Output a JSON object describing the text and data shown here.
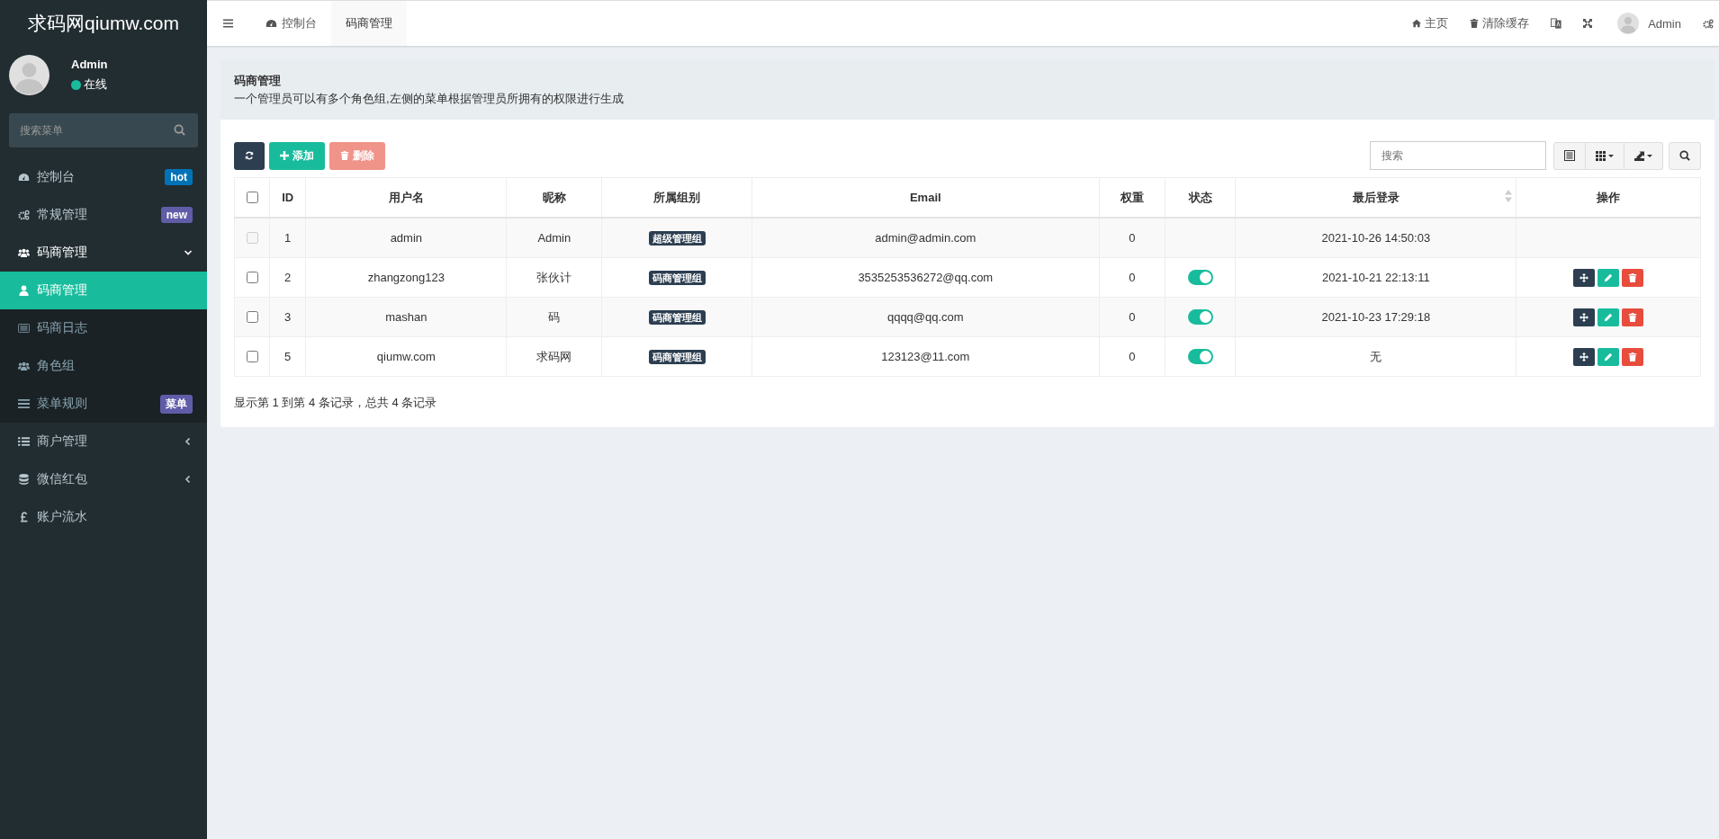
{
  "brand": "求码网qiumw.com",
  "user": {
    "name": "Admin",
    "status": "在线",
    "online": true
  },
  "menu_search": {
    "placeholder": "搜索菜单"
  },
  "sidebar": {
    "items": [
      {
        "kind": "link",
        "label": "控制台",
        "badge": {
          "text": "hot",
          "color": "#0073b7"
        }
      },
      {
        "kind": "link",
        "label": "常规管理",
        "badge": {
          "text": "new",
          "color": "#605ca8"
        }
      },
      {
        "kind": "group",
        "label": "码商管理",
        "expanded": true,
        "children": [
          {
            "label": "码商管理",
            "selected": true
          },
          {
            "label": "码商日志",
            "selected": false
          },
          {
            "label": "角色组",
            "selected": false
          },
          {
            "label": "菜单规则",
            "selected": false,
            "badge": {
              "text": "菜单",
              "color": "#605ca8"
            }
          }
        ]
      },
      {
        "kind": "group",
        "label": "商户管理",
        "expanded": false
      },
      {
        "kind": "group",
        "label": "微信红包",
        "expanded": false
      },
      {
        "kind": "link",
        "label": "账户流水"
      }
    ]
  },
  "nav_tabs": [
    {
      "label": "控制台",
      "selected": false
    },
    {
      "label": "码商管理",
      "selected": true
    }
  ],
  "top_actions": [
    {
      "label": "主页"
    },
    {
      "label": "清除缓存"
    }
  ],
  "account": {
    "name": "Admin"
  },
  "page_header": {
    "title": "码商管理",
    "description": "一个管理员可以有多个角色组,左侧的菜单根据管理员所拥有的权限进行生成"
  },
  "toolbar": {
    "buttons": [
      {
        "kind": "refresh"
      },
      {
        "kind": "add",
        "label": "添加"
      },
      {
        "kind": "delete",
        "label": "删除",
        "disabled": true
      }
    ],
    "search": {
      "placeholder": "搜索"
    }
  },
  "table": {
    "header_checkbox": {
      "checked": false
    },
    "columns": [
      {
        "label": "ID",
        "sortable": false
      },
      {
        "label": "用户名",
        "sortable": false
      },
      {
        "label": "昵称",
        "sortable": false
      },
      {
        "label": "所属组别",
        "sortable": false
      },
      {
        "label": "Email",
        "sortable": false
      },
      {
        "label": "权重",
        "sortable": false
      },
      {
        "label": "状态",
        "sortable": false
      },
      {
        "label": "最后登录",
        "sortable": true
      },
      {
        "label": "操作",
        "sortable": false
      }
    ],
    "rows": [
      {
        "checked": false,
        "disabled": true,
        "id": "1",
        "username": "admin",
        "nickname": "Admin",
        "group": "超级管理组",
        "email": "admin@admin.com",
        "weight": "0",
        "last_login": "2021-10-26 14:50:03",
        "actions_visible": false
      },
      {
        "checked": false,
        "disabled": false,
        "id": "2",
        "username": "zhangzong123",
        "nickname": "张伙计",
        "group": "码商管理组",
        "email": "3535253536272@qq.com",
        "weight": "0",
        "status_on": true,
        "last_login": "2021-10-21 22:13:11",
        "actions_visible": true
      },
      {
        "checked": false,
        "disabled": false,
        "id": "3",
        "username": "mashan",
        "nickname": "码",
        "group": "码商管理组",
        "email": "qqqq@qq.com",
        "weight": "0",
        "status_on": true,
        "last_login": "2021-10-23 17:29:18",
        "actions_visible": true
      },
      {
        "checked": false,
        "disabled": false,
        "id": "5",
        "username": "qiumw.com",
        "nickname": "求码网",
        "group": "码商管理组",
        "email": "123123@11.com",
        "weight": "0",
        "status_on": true,
        "last_login": "无",
        "actions_visible": true
      }
    ]
  },
  "pagination_info": "显示第 1 到第 4 条记录，总共 4 条记录"
}
